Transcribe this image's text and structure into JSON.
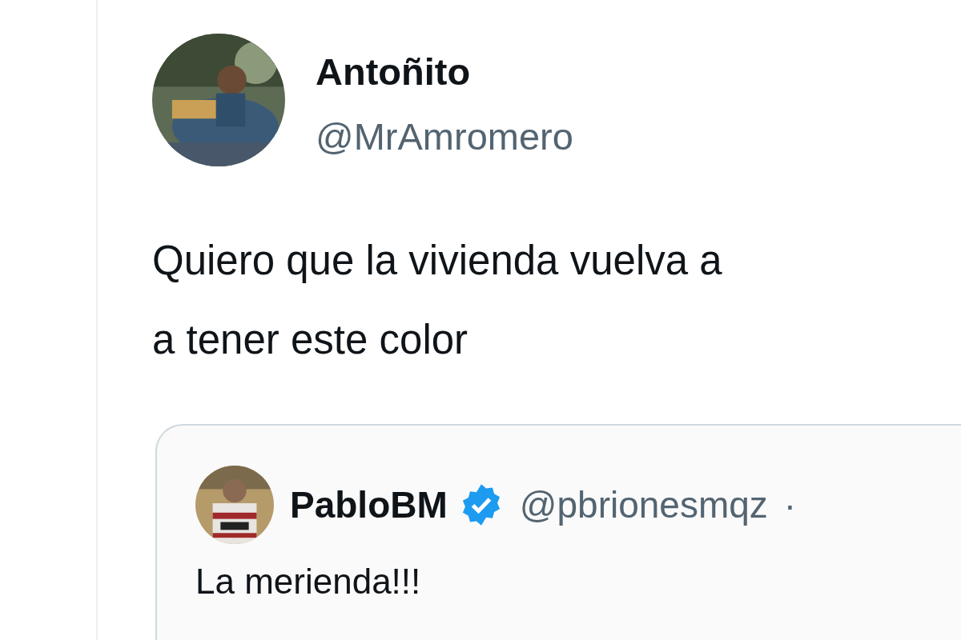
{
  "tweet": {
    "author": {
      "name": "Antoñito",
      "handle": "@MrAmromero"
    },
    "text_lines": [
      "Quiero que la vivienda vuelva a",
      "a tener este color"
    ],
    "quoted": {
      "author": {
        "name": "PabloBM",
        "verified": true,
        "handle": "@pbrionesmqz",
        "separator": "·"
      },
      "text": "La merienda!!!"
    }
  }
}
